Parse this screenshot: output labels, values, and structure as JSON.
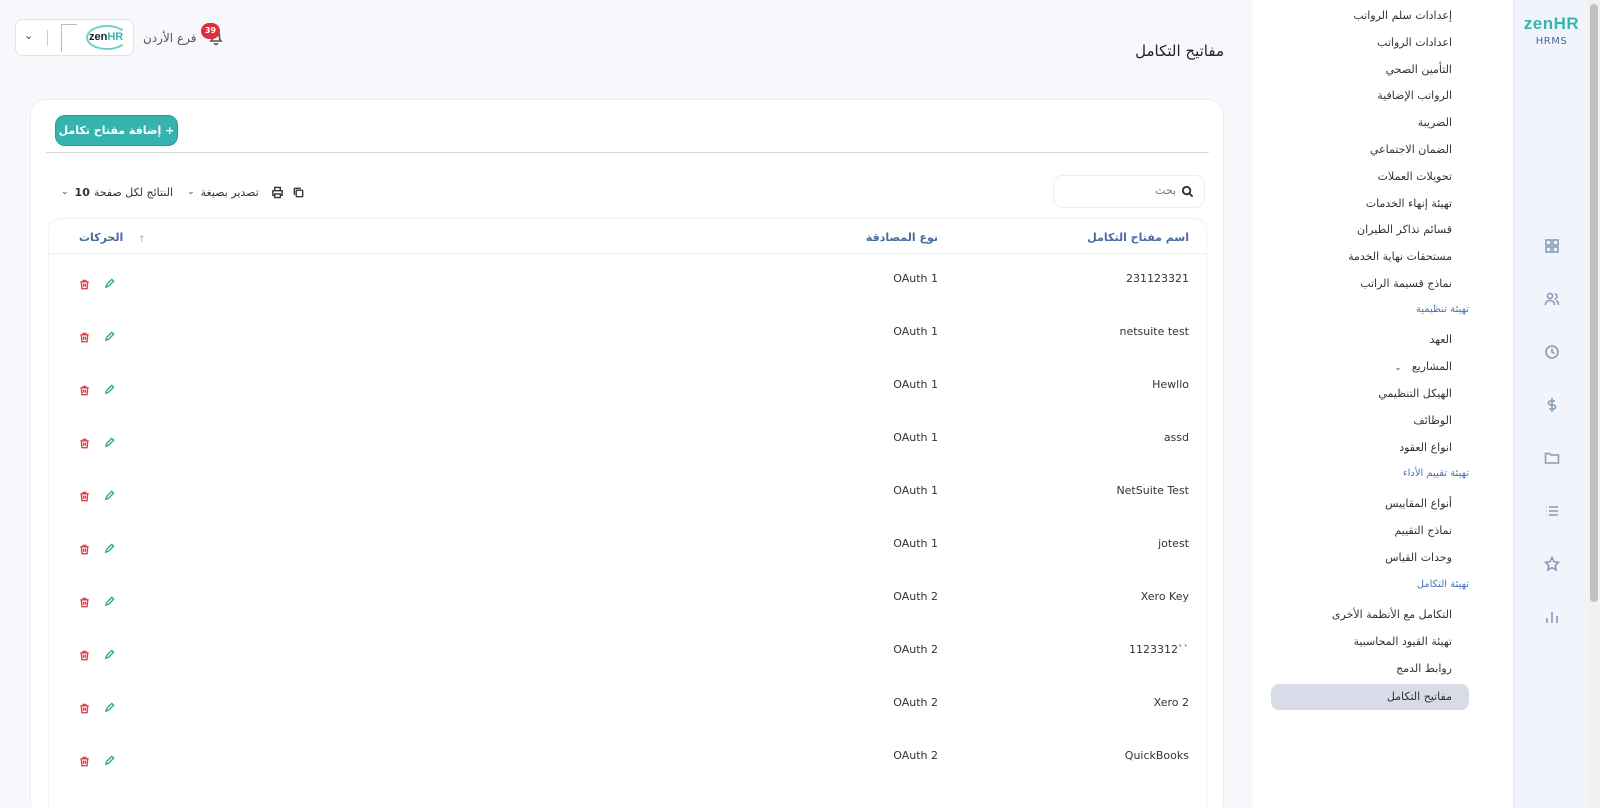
{
  "brand": {
    "logo_main": "zen",
    "logo_accent": "HR",
    "product": "HRMS"
  },
  "header": {
    "branch": "فرع الأردن",
    "notifications_count": "39",
    "page_title": "مفاتيح التكامل"
  },
  "menu": {
    "items": [
      "إعدادات سلم الرواتب",
      "اعدادات الرواتب",
      "التأمين الصحي",
      "الرواتب الإضافية",
      "الضريبة",
      "الضمان الاجتماعي",
      "تحويلات العملات",
      "تهيئة إنهاء الخدمات",
      "قسائم تذاكر الطيران",
      "مستحقات نهاية الخدمة",
      "نماذج قسيمة الراتب"
    ],
    "section_org": "تهيئة تنظيمية",
    "org_items": [
      "العهد",
      "المشاريع",
      "الهيكل التنظيمي",
      "الوظائف",
      "انواع العقود"
    ],
    "section_perf": "تهيئة تقييم الأداء",
    "perf_items": [
      "أنواع المقاييس",
      "نماذج التقييم",
      "وحدات القياس"
    ],
    "section_integ": "تهيئة التكامل",
    "integ_items": [
      "التكامل مع الأنظمة الأخرى",
      "تهيئة القيود المحاسبية",
      "روابط الدمج",
      "مفاتيح التكامل"
    ]
  },
  "toolbar": {
    "add_button": "+ إضافة مفتاح تكامل",
    "search_placeholder": "بحث",
    "export_label": "تصدير بصيغة",
    "per_page_label": "النتائج لكل صفحة",
    "per_page_value": "10"
  },
  "table": {
    "headers": {
      "name": "اسم مفتاح التكامل",
      "auth": "نوع المصادقة",
      "actions": "الحركات"
    },
    "rows": [
      {
        "name": "231123321",
        "auth": "OAuth 1"
      },
      {
        "name": "netsuite test",
        "auth": "OAuth 1"
      },
      {
        "name": "Hewllo",
        "auth": "OAuth 1"
      },
      {
        "name": "assd",
        "auth": "OAuth 1"
      },
      {
        "name": "NetSuite Test",
        "auth": "OAuth 1"
      },
      {
        "name": "jotest",
        "auth": "OAuth 1"
      },
      {
        "name": "Xero Key",
        "auth": "OAuth 2"
      },
      {
        "name": "1123312``",
        "auth": "OAuth 2"
      },
      {
        "name": "Xero 2",
        "auth": "OAuth 2"
      },
      {
        "name": "QuickBooks",
        "auth": "OAuth 2"
      }
    ]
  },
  "colors": {
    "accent": "#35b3ae",
    "link": "#4a73b8",
    "danger": "#e0404a",
    "edit": "#3aa87a"
  }
}
